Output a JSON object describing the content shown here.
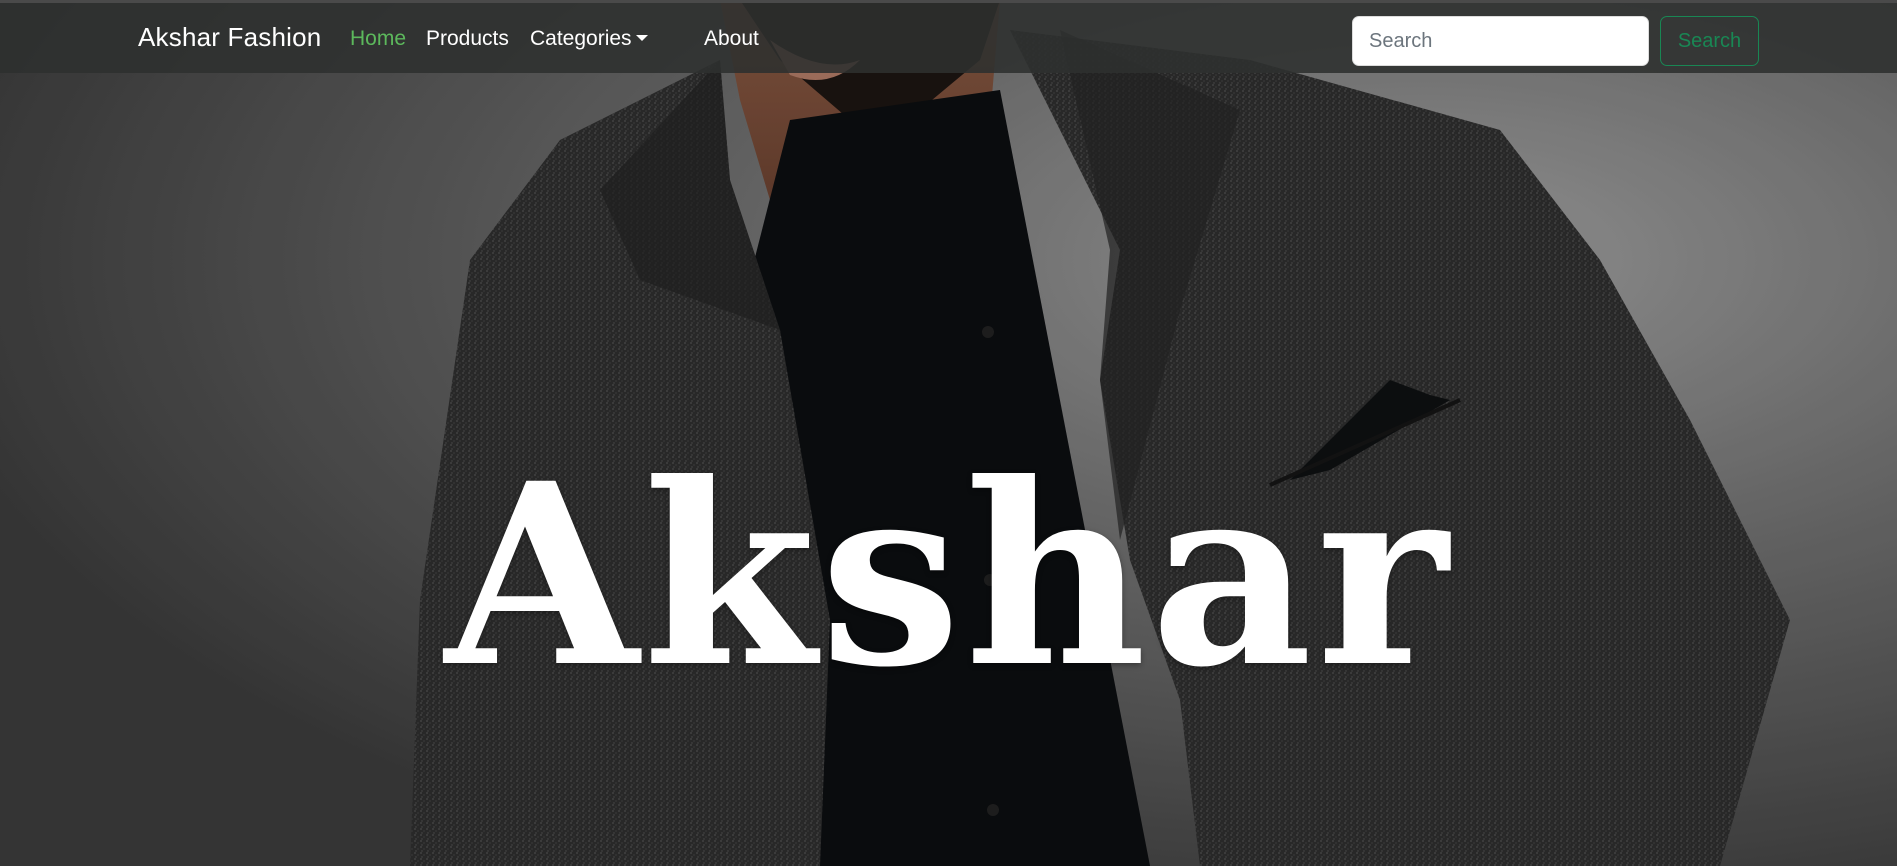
{
  "navbar": {
    "brand": "Akshar Fashion",
    "links": [
      {
        "label": "Home",
        "active": true
      },
      {
        "label": "Products",
        "active": false
      },
      {
        "label": "Categories",
        "active": false,
        "has_dropdown": true
      },
      {
        "label": "About",
        "active": false
      }
    ],
    "search": {
      "placeholder": "Search",
      "value": "",
      "button_label": "Search"
    }
  },
  "hero": {
    "title": "Akshar",
    "image_description_icon": "man-in-blazer-photo"
  },
  "colors": {
    "navbar_bg": "#2d302f",
    "active_link": "#5cb85c",
    "search_button": "#198754",
    "text": "#ffffff"
  }
}
